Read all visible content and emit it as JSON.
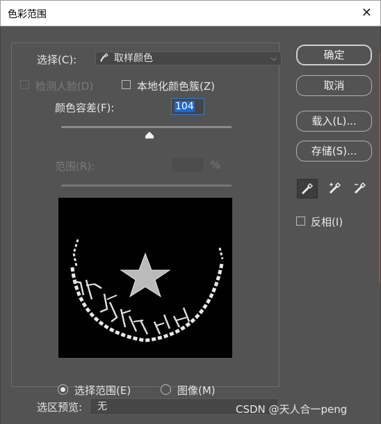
{
  "window": {
    "title": "色彩范围",
    "close_glyph": "✕"
  },
  "select": {
    "label": "选择(C):",
    "value": "取样颜色",
    "icon": "eyedropper-icon"
  },
  "detect_faces": {
    "label": "检测人脸(D)",
    "checked": false,
    "enabled": false
  },
  "localized_clusters": {
    "label": "本地化颜色簇(Z)",
    "checked": false
  },
  "fuzziness": {
    "label": "颜色容差(F):",
    "value": "104",
    "slider_fraction": 0.5
  },
  "range": {
    "label": "范围(R):",
    "value": "",
    "unit": "%",
    "enabled": false
  },
  "view": {
    "selection_label": "选择范围(E)",
    "image_label": "图像(M)",
    "selected": "selection"
  },
  "buttons": {
    "ok": "确定",
    "cancel": "取消",
    "load": "载入(L)...",
    "save": "存储(S)..."
  },
  "tools": [
    "eyedropper-icon",
    "eyedropper-plus-icon",
    "eyedropper-minus-icon"
  ],
  "invert": {
    "label": "反相(I)",
    "checked": false
  },
  "selection_preview": {
    "label": "选区预览:",
    "value": "无"
  },
  "watermark": "CSDN @天人合一peng"
}
